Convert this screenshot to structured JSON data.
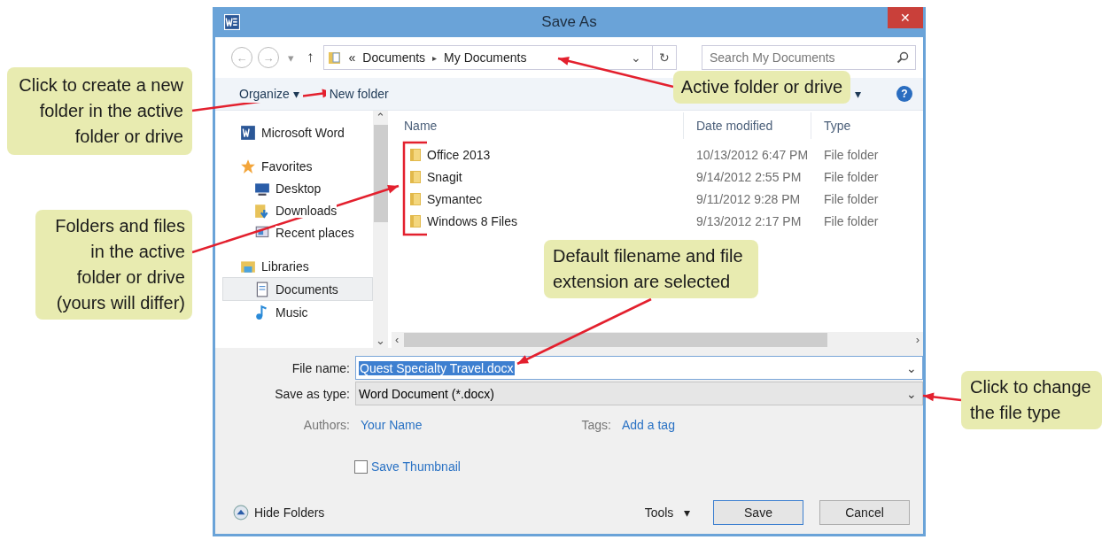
{
  "window": {
    "title": "Save As",
    "close": "✕"
  },
  "address": {
    "back": "←",
    "forward": "→",
    "recent": "▾",
    "up": "↑",
    "overflow": "«",
    "path": [
      "Documents",
      "My Documents"
    ],
    "separator": "▸",
    "dropdown": "⌄",
    "refresh": "↻"
  },
  "search": {
    "placeholder": "Search My Documents"
  },
  "toolbar": {
    "organize": "Organize",
    "organize_caret": "▾",
    "new_folder": "New folder",
    "view_caret": "▾",
    "help": "?"
  },
  "nav": [
    {
      "label": "Microsoft Word",
      "kind": "top",
      "selected": false
    },
    {
      "label": "Favorites",
      "kind": "top",
      "selected": false
    },
    {
      "label": "Desktop",
      "kind": "sub",
      "selected": false
    },
    {
      "label": "Downloads",
      "kind": "sub",
      "selected": false
    },
    {
      "label": "Recent places",
      "kind": "sub",
      "selected": false
    },
    {
      "label": "Libraries",
      "kind": "top",
      "selected": false
    },
    {
      "label": "Documents",
      "kind": "sub",
      "selected": true
    },
    {
      "label": "Music",
      "kind": "sub",
      "selected": false
    }
  ],
  "nav_scroll": {
    "up": "⌃",
    "down": "⌄"
  },
  "columns": [
    "Name",
    "Date modified",
    "Type"
  ],
  "files": [
    {
      "name": "Office 2013",
      "date": "10/13/2012 6:47 PM",
      "type": "File folder"
    },
    {
      "name": "Snagit",
      "date": "9/14/2012 2:55 PM",
      "type": "File folder"
    },
    {
      "name": "Symantec",
      "date": "9/11/2012 9:28 PM",
      "type": "File folder"
    },
    {
      "name": "Windows 8 Files",
      "date": "9/13/2012 2:17 PM",
      "type": "File folder"
    }
  ],
  "hscroll": {
    "left": "‹",
    "right": "›"
  },
  "file_name": {
    "label": "File name:",
    "value": "Quest Specialty Travel.docx",
    "text_selected": true,
    "caret": "⌄"
  },
  "save_type": {
    "label": "Save as type:",
    "value": "Word Document (*.docx)",
    "caret": "⌄"
  },
  "authors": {
    "label": "Authors:",
    "value": "Your Name"
  },
  "tags": {
    "label": "Tags:",
    "value": "Add a tag"
  },
  "thumbnail": {
    "label": "Save Thumbnail",
    "checked": false
  },
  "hide_folders": "Hide Folders",
  "tools": {
    "label": "Tools",
    "caret": "▾"
  },
  "buttons": [
    "Save",
    "Cancel"
  ],
  "callouts": [
    "Click to create a new folder in the active folder or drive",
    "Active folder or drive",
    "Folders and files in the active folder or drive (yours will differ)",
    "Default filename and file extension are selected",
    "Click to change the file type"
  ]
}
